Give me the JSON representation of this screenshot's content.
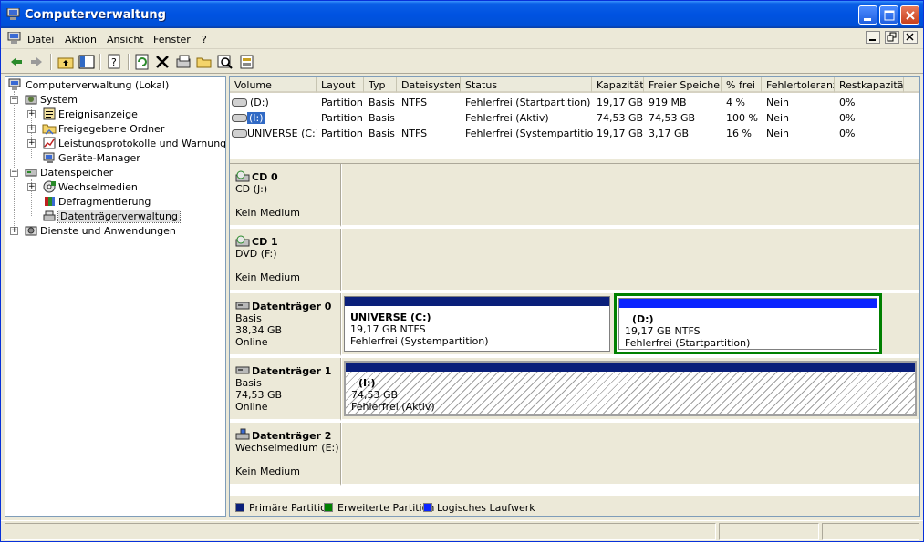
{
  "window": {
    "title": "Computerverwaltung",
    "controls": {
      "minimize": "minimize",
      "maximize": "maximize",
      "close": "close"
    }
  },
  "menu": [
    "Datei",
    "Aktion",
    "Ansicht",
    "Fenster",
    "?"
  ],
  "toolbar_icons": [
    "back-icon",
    "forward-icon",
    "up-folder-icon",
    "show-tree-icon",
    "properties-icon",
    "refresh-icon",
    "delete-icon",
    "disk-properties-icon",
    "open-folder-icon",
    "search-icon",
    "wizard-icon"
  ],
  "tree": {
    "root": "Computerverwaltung (Lokal)",
    "system": "System",
    "system_children": [
      "Ereignisanzeige",
      "Freigegebene Ordner",
      "Leistungsprotokolle und Warnungen",
      "Geräte-Manager"
    ],
    "storage": "Datenspeicher",
    "storage_children": [
      "Wechselmedien",
      "Defragmentierung",
      "Datenträgerverwaltung"
    ],
    "services": "Dienste und Anwendungen"
  },
  "list": {
    "columns": [
      "Volume",
      "Layout",
      "Typ",
      "Dateisystem",
      "Status",
      "Kapazität",
      "Freier Speicher",
      "% frei",
      "Fehlertoleranz",
      "Restkapazität"
    ],
    "rows": [
      [
        "(D:)",
        "Partition",
        "Basis",
        "NTFS",
        "Fehlerfrei (Startpartition)",
        "19,17 GB",
        "919 MB",
        "4 %",
        "Nein",
        "0%"
      ],
      [
        "(I:)",
        "Partition",
        "Basis",
        "",
        "Fehlerfrei (Aktiv)",
        "74,53 GB",
        "74,53 GB",
        "100 %",
        "Nein",
        "0%"
      ],
      [
        "UNIVERSE (C:)",
        "Partition",
        "Basis",
        "NTFS",
        "Fehlerfrei (Systempartition)",
        "19,17 GB",
        "3,17 GB",
        "16 %",
        "Nein",
        "0%"
      ]
    ]
  },
  "disks": [
    {
      "name": "CD 0",
      "line1": "CD (J:)",
      "line2": "",
      "line3": "Kein Medium"
    },
    {
      "name": "CD 1",
      "line1": "DVD (F:)",
      "line2": "",
      "line3": "Kein Medium"
    },
    {
      "name": "Datenträger 0",
      "line1": "Basis",
      "line2": "38,34 GB",
      "line3": "Online"
    },
    {
      "name": "Datenträger 1",
      "line1": "Basis",
      "line2": "74,53 GB",
      "line3": "Online"
    },
    {
      "name": "Datenträger 2",
      "line1": "Wechselmedium (E:)",
      "line2": "",
      "line3": "Kein Medium"
    }
  ],
  "partitions": {
    "c": {
      "name": "UNIVERSE  (C:)",
      "size": "19,17 GB NTFS",
      "status": "Fehlerfrei (Systempartition)"
    },
    "d": {
      "name": "(D:)",
      "size": "19,17 GB NTFS",
      "status": "Fehlerfrei (Startpartition)"
    },
    "i": {
      "name": "(I:)",
      "size": "74,53 GB",
      "status": "Fehlerfrei (Aktiv)"
    }
  },
  "legend": [
    "Primäre Partition",
    "Erweiterte Partition",
    "Logisches Laufwerk"
  ],
  "colors": {
    "primary": "#0a1f7a",
    "extended": "#008000",
    "logical": "#0a24ff",
    "selection": "#316ac5"
  }
}
